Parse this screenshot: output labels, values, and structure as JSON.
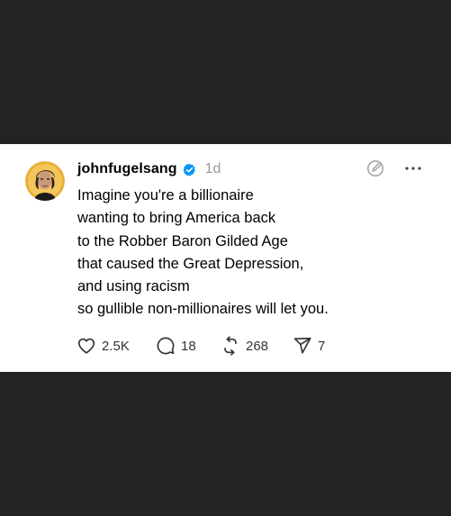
{
  "post": {
    "username": "johnfugelsang",
    "verified": true,
    "time": "1d",
    "text_lines": [
      "Imagine you're a billionaire",
      "wanting to bring America back",
      "to the Robber Baron Gilded Age",
      "that caused the Great Depression,",
      "and using racism",
      "so gullible non-millionaires will let you."
    ],
    "actions": {
      "likes": "2.5K",
      "replies": "18",
      "reposts": "268",
      "shares": "7"
    }
  },
  "icons": {
    "avatar": "avatar",
    "verified": "verified-badge-icon",
    "edit": "edit-icon",
    "more": "more-icon",
    "like": "heart-icon",
    "reply": "reply-icon",
    "repost": "repost-icon",
    "share": "share-icon"
  },
  "colors": {
    "background": "#232323",
    "card": "#ffffff",
    "verified": "#0095f6",
    "muted": "#999999"
  }
}
